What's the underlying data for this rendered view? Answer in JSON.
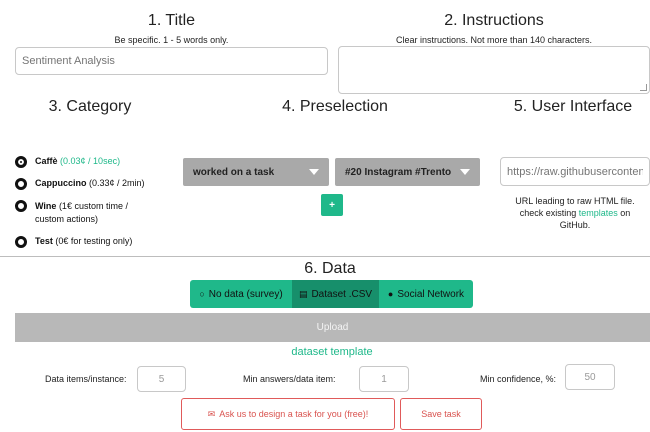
{
  "sections": {
    "title": {
      "heading": "1. Title",
      "hint": "Be specific. 1 - 5 words only.",
      "placeholder": "Sentiment Analysis"
    },
    "instructions": {
      "heading": "2. Instructions",
      "hint": "Clear instructions. Not more than 140 characters."
    },
    "category": {
      "heading": "3. Category"
    },
    "preselection": {
      "heading": "4. Preselection"
    },
    "user_interface": {
      "heading": "5. User Interface"
    },
    "data": {
      "heading": "6. Data"
    }
  },
  "category": {
    "options": [
      {
        "name": "Caffè",
        "price": "(0.03¢ / 10sec)",
        "checked": true
      },
      {
        "name": "Cappuccino",
        "price": "(0.33¢ / 2min)",
        "checked": false
      },
      {
        "name": "Wine",
        "price": "(1€ custom time /",
        "price2": "custom actions)",
        "checked": false
      },
      {
        "name": "Test",
        "price": "(0€ for testing only)",
        "checked": false
      }
    ]
  },
  "preselection": {
    "select1": "worked on a task",
    "select2": "#20 Instagram #Trento",
    "add_label": "+"
  },
  "user_interface": {
    "placeholder": "https://raw.githubusercontent.",
    "help_line1": "URL leading to raw HTML file.",
    "help_line2_pre": "check existing ",
    "help_link": "templates",
    "help_line2_post": " on",
    "help_line3": "GitHub."
  },
  "data": {
    "segments": [
      {
        "label": "No data (survey)",
        "icon": "circle-icon",
        "glyph": "○"
      },
      {
        "label": "Dataset .CSV",
        "icon": "file-icon",
        "glyph": "▤"
      },
      {
        "label": "Social Network",
        "icon": "globe-icon",
        "glyph": "●"
      }
    ],
    "upload_label": "Upload",
    "dataset_template_link": "dataset template",
    "items_label": "Data items/instance:",
    "items_value": "5",
    "min_answers_label": "Min answers/data item:",
    "min_answers_value": "1",
    "min_conf_label": "Min confidence, %:",
    "min_conf_value": "50"
  },
  "actions": {
    "design_label": "Ask us to design a task for you (free)!",
    "design_icon": "envelope-icon",
    "save_label": "Save task"
  },
  "colors": {
    "accent": "#1fb88a",
    "select_bg": "#a9a9a9",
    "danger": "#d9534f",
    "upload_bg": "#b8b8b8"
  }
}
